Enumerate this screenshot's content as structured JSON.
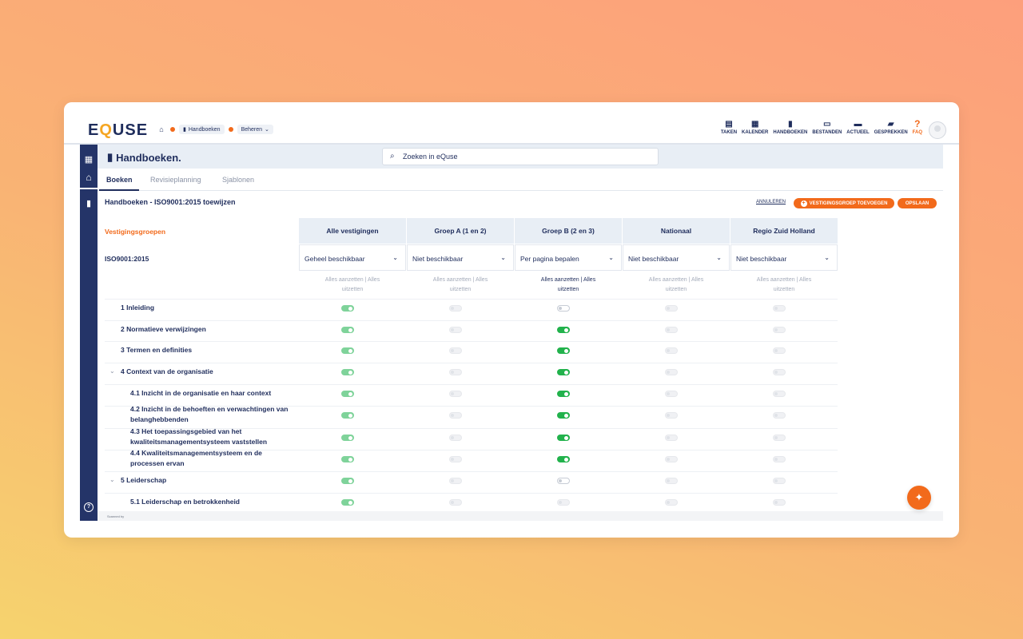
{
  "app": {
    "logo_pre": "E",
    "logo_q": "Q",
    "logo_post": "USE"
  },
  "breadcrumbs": {
    "item1": "Handboeken",
    "item2": "Beheren"
  },
  "topnav": [
    {
      "label": "TAKEN",
      "icon": "clipboard-icon"
    },
    {
      "label": "KALENDER",
      "icon": "calendar-icon"
    },
    {
      "label": "HANDBOEKEN",
      "icon": "book-icon"
    },
    {
      "label": "BESTANDEN",
      "icon": "archive-icon"
    },
    {
      "label": "ACTUEEL",
      "icon": "news-icon"
    },
    {
      "label": "GESPREKKEN",
      "icon": "chat-icon"
    },
    {
      "label": "FAQ",
      "icon": "question-icon"
    }
  ],
  "subheader": {
    "title": "Handboeken.",
    "search_placeholder": "Zoeken in eQuse"
  },
  "tabs": [
    "Boeken",
    "Revisieplanning",
    "Sjablonen"
  ],
  "page": {
    "title": "Handboeken - ISO9001:2015 toewijzen",
    "cancel": "ANNULEREN",
    "add_group": "VESTIGINGSGROEP TOEVOEGEN",
    "save": "OPSLAAN"
  },
  "table": {
    "groups_label": "Vestigingsgroepen",
    "book_label": "ISO9001:2015",
    "columns": [
      {
        "name": "Alle vestigingen",
        "select": "Geheel beschikbaar"
      },
      {
        "name": "Groep A (1 en 2)",
        "select": "Niet beschikbaar"
      },
      {
        "name": "Groep B (2 en 3)",
        "select": "Per pagina bepalen"
      },
      {
        "name": "Nationaal",
        "select": "Niet beschikbaar"
      },
      {
        "name": "Regio Zuid Holland",
        "select": "Niet beschikbaar"
      }
    ],
    "bulk_on": "Alles aanzetten",
    "bulk_sep": "|",
    "bulk_off": "Alles",
    "bulk_off2": "uitzetten",
    "rows": [
      {
        "label": "1 Inleiding",
        "states": [
          1,
          0,
          0,
          0,
          0
        ]
      },
      {
        "label": "2 Normatieve verwijzingen",
        "states": [
          1,
          0,
          1,
          0,
          0
        ]
      },
      {
        "label": "3 Termen en definities",
        "states": [
          1,
          0,
          1,
          0,
          0
        ]
      },
      {
        "label": "4 Context van de organisatie",
        "states": [
          1,
          0,
          1,
          0,
          0
        ]
      },
      {
        "label": "4.1 Inzicht in de organisatie en haar context",
        "states": [
          1,
          0,
          1,
          0,
          0
        ]
      },
      {
        "label": "4.2 Inzicht in de behoeften en verwachtingen van belanghebbenden",
        "states": [
          1,
          0,
          1,
          0,
          0
        ]
      },
      {
        "label": "4.3 Het toepassingsgebied van het kwaliteitsmanagementsysteem vaststellen",
        "states": [
          1,
          0,
          1,
          0,
          0
        ]
      },
      {
        "label": "4.4 Kwaliteitsmanagementsysteem en de processen ervan",
        "states": [
          1,
          0,
          1,
          0,
          0
        ]
      },
      {
        "label": "5 Leiderschap",
        "states": [
          1,
          0,
          0,
          0,
          0
        ]
      },
      {
        "label": "5.1 Leiderschap en betrokkenheid",
        "states": [
          1,
          0,
          0,
          0,
          0
        ]
      }
    ]
  },
  "footer": {
    "text": "Scanned by"
  }
}
